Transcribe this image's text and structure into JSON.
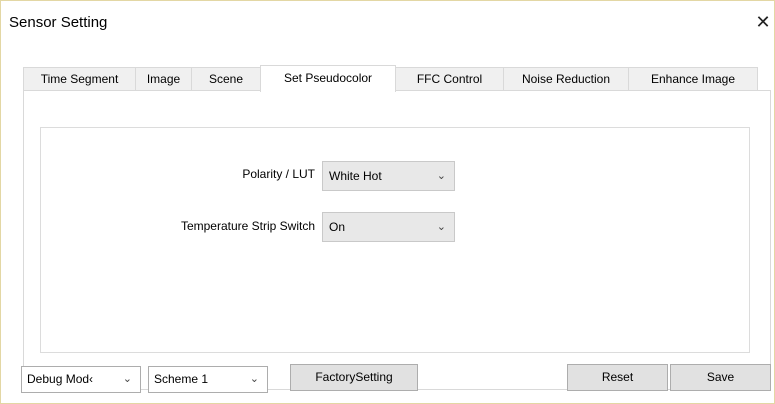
{
  "window": {
    "title": "Sensor Setting",
    "close_glyph": "✕"
  },
  "tabs": [
    {
      "label": "Time Segment"
    },
    {
      "label": "Image"
    },
    {
      "label": "Scene"
    },
    {
      "label": "Set Pseudocolor",
      "active": true
    },
    {
      "label": "FFC Control"
    },
    {
      "label": "Noise Reduction"
    },
    {
      "label": "Enhance Image"
    }
  ],
  "pseudocolor": {
    "polarity_label": "Polarity / LUT",
    "polarity_value": "White Hot",
    "strip_label": "Temperature Strip Switch",
    "strip_value": "On"
  },
  "bottom": {
    "mode_value": "Debug Mod‹",
    "scheme_value": "Scheme 1",
    "factory_label": "FactorySetting",
    "reset_label": "Reset",
    "save_label": "Save"
  },
  "icons": {
    "chevron": "chevron-down-icon",
    "close": "close-icon"
  }
}
